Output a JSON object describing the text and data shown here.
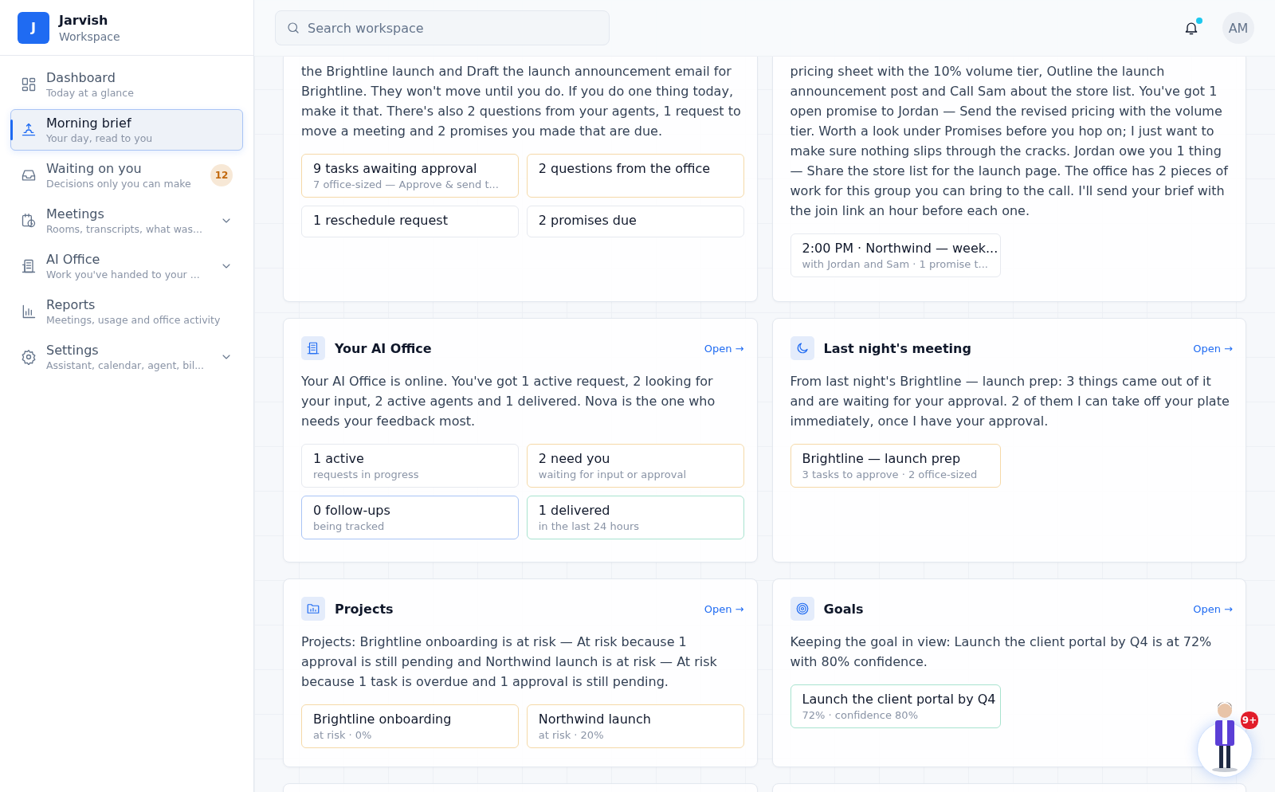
{
  "brand": {
    "logo": "J",
    "name": "Jarvish",
    "subtitle": "Workspace"
  },
  "sidebar": {
    "items": [
      {
        "title": "Dashboard",
        "subtitle": "Today at a glance",
        "selected": false
      },
      {
        "title": "Morning brief",
        "subtitle": "Your day, read to you",
        "selected": true
      },
      {
        "title": "Waiting on you",
        "subtitle": "Decisions only you can make",
        "selected": false,
        "badge": "12"
      },
      {
        "title": "Meetings",
        "subtitle": "Rooms, transcripts, what was...",
        "selected": false,
        "expanded": false
      },
      {
        "title": "AI Office",
        "subtitle": "Work you've handed to your ...",
        "selected": false,
        "expanded": false
      },
      {
        "title": "Reports",
        "subtitle": "Meetings, usage and office activity",
        "selected": false
      },
      {
        "title": "Settings",
        "subtitle": "Assistant, calendar, agent, bil...",
        "selected": false,
        "expanded": false
      }
    ]
  },
  "header": {
    "search": {
      "placeholder": "Search workspace"
    },
    "notifications": {
      "unread": true
    },
    "avatar": "AM"
  },
  "cards": [
    {
      "kind": "clipped",
      "text": "the Brightline launch and Draft the launch announcement email for Brightline. They won't move until you do. If you do one thing today, make it that. There's also 2 questions from your agents, 1 request to move a meeting and 2 promises you made that are due.",
      "chips": [
        {
          "title": "9 tasks awaiting approval",
          "sub": "7 office-sized — Approve & send t...",
          "color": "#f5d9a8"
        },
        {
          "title": "2 questions from the office",
          "color": "#f5d9a8"
        },
        {
          "title": "1 reschedule request",
          "color": "#e6e9ef"
        },
        {
          "title": "2 promises due",
          "color": "#e6e9ef"
        }
      ]
    },
    {
      "kind": "clipped",
      "text": "pricing sheet with the 10% volume tier, Outline the launch announcement post and Call Sam about the store list. You've got 1 open promise to Jordan — Send the revised pricing with the volume tier. Worth a look under Promises before you hop on; I just want to make sure nothing slips through the cracks. Jordan owe you 1 thing — Share the store list for the launch page. The office has 2 pieces of work for this group you can bring to the call. I'll send your brief with the join link an hour before each one.",
      "chips": [
        {
          "title": "2:00 PM · Northwind — week...",
          "sub": "with Jordan and Sam · 1 promise t...",
          "color": "#e6e9ef"
        }
      ]
    },
    {
      "kind": "full",
      "title": "Your AI Office",
      "link": "Open →",
      "text": "Your AI Office is online. You've got 1 active request, 2 looking for your input, 2 active agents and 1 delivered. Nova is the one who needs your feedback most.",
      "chips": [
        {
          "title": "1 active",
          "sub": "requests in progress",
          "color": "#e6e9ef"
        },
        {
          "title": "2 need you",
          "sub": "waiting for input or approval",
          "color": "#f5d9a8"
        },
        {
          "title": "0 follow-ups",
          "sub": "being tracked",
          "color": "#a9c4f5"
        },
        {
          "title": "1 delivered",
          "sub": "in the last 24 hours",
          "color": "#a8e3cf"
        }
      ]
    },
    {
      "kind": "full",
      "title": "Last night's meeting",
      "link": "Open →",
      "text": "From last night's Brightline — launch prep: 3 things came out of it and are waiting for your approval. 2 of them I can take off your plate immediately, once I have your approval.",
      "chips": [
        {
          "title": "Brightline — launch prep",
          "sub": "3 tasks to approve · 2 office-sized",
          "color": "#f5d9a8"
        }
      ]
    },
    {
      "kind": "full",
      "title": "Projects",
      "link": "Open →",
      "text": "Projects: Brightline onboarding is at risk — At risk because 1 approval is still pending and Northwind launch is at risk — At risk because 1 task is overdue and 1 approval is still pending.",
      "chips": [
        {
          "title": "Brightline onboarding",
          "sub": "at risk · 0%",
          "color": "#f5d9a8"
        },
        {
          "title": "Northwind launch",
          "sub": "at risk · 20%",
          "color": "#f5d9a8"
        }
      ]
    },
    {
      "kind": "full",
      "title": "Goals",
      "link": "Open →",
      "text": "Keeping the goal in view: Launch the client portal by Q4 is at 72% with 80% confidence.",
      "chips": [
        {
          "title": "Launch the client portal by Q4",
          "sub": "72% · confidence 80%",
          "color": "#a8e3cf"
        }
      ]
    },
    {
      "kind": "empty"
    },
    {
      "kind": "empty"
    }
  ],
  "assistant": {
    "badge": "9+"
  }
}
